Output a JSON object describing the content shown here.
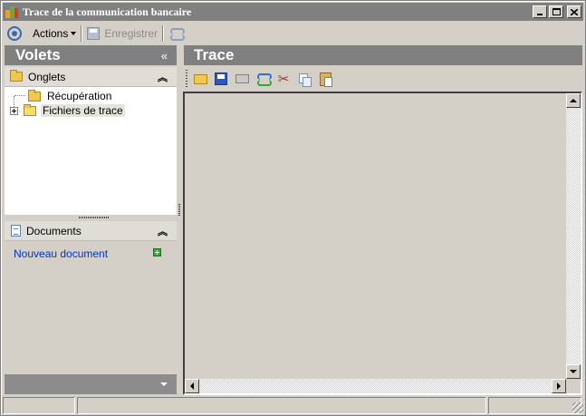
{
  "window": {
    "title": "Trace de la communication bancaire"
  },
  "toolbar": {
    "actions_label": "Actions",
    "save_label": "Enregistrer"
  },
  "left_pane": {
    "header": "Volets",
    "collapse_glyph": "«",
    "onglets": {
      "label": "Onglets",
      "collapse_glyph": "︽",
      "tree": [
        {
          "label": "Récupération",
          "expandable": false,
          "selected": false
        },
        {
          "label": "Fichiers de trace",
          "expandable": true,
          "selected": true
        }
      ]
    },
    "documents": {
      "label": "Documents",
      "collapse_glyph": "︽",
      "new_doc_link": "Nouveau document"
    }
  },
  "right_pane": {
    "header": "Trace",
    "toolbar_icons": [
      "open-folder-icon",
      "save-icon",
      "print-icon",
      "refresh-icon",
      "cut-icon",
      "copy-icon",
      "paste-icon"
    ]
  },
  "colors": {
    "header_bg": "#808080",
    "window_bg": "#d4d0c8",
    "link": "#0033cc"
  }
}
